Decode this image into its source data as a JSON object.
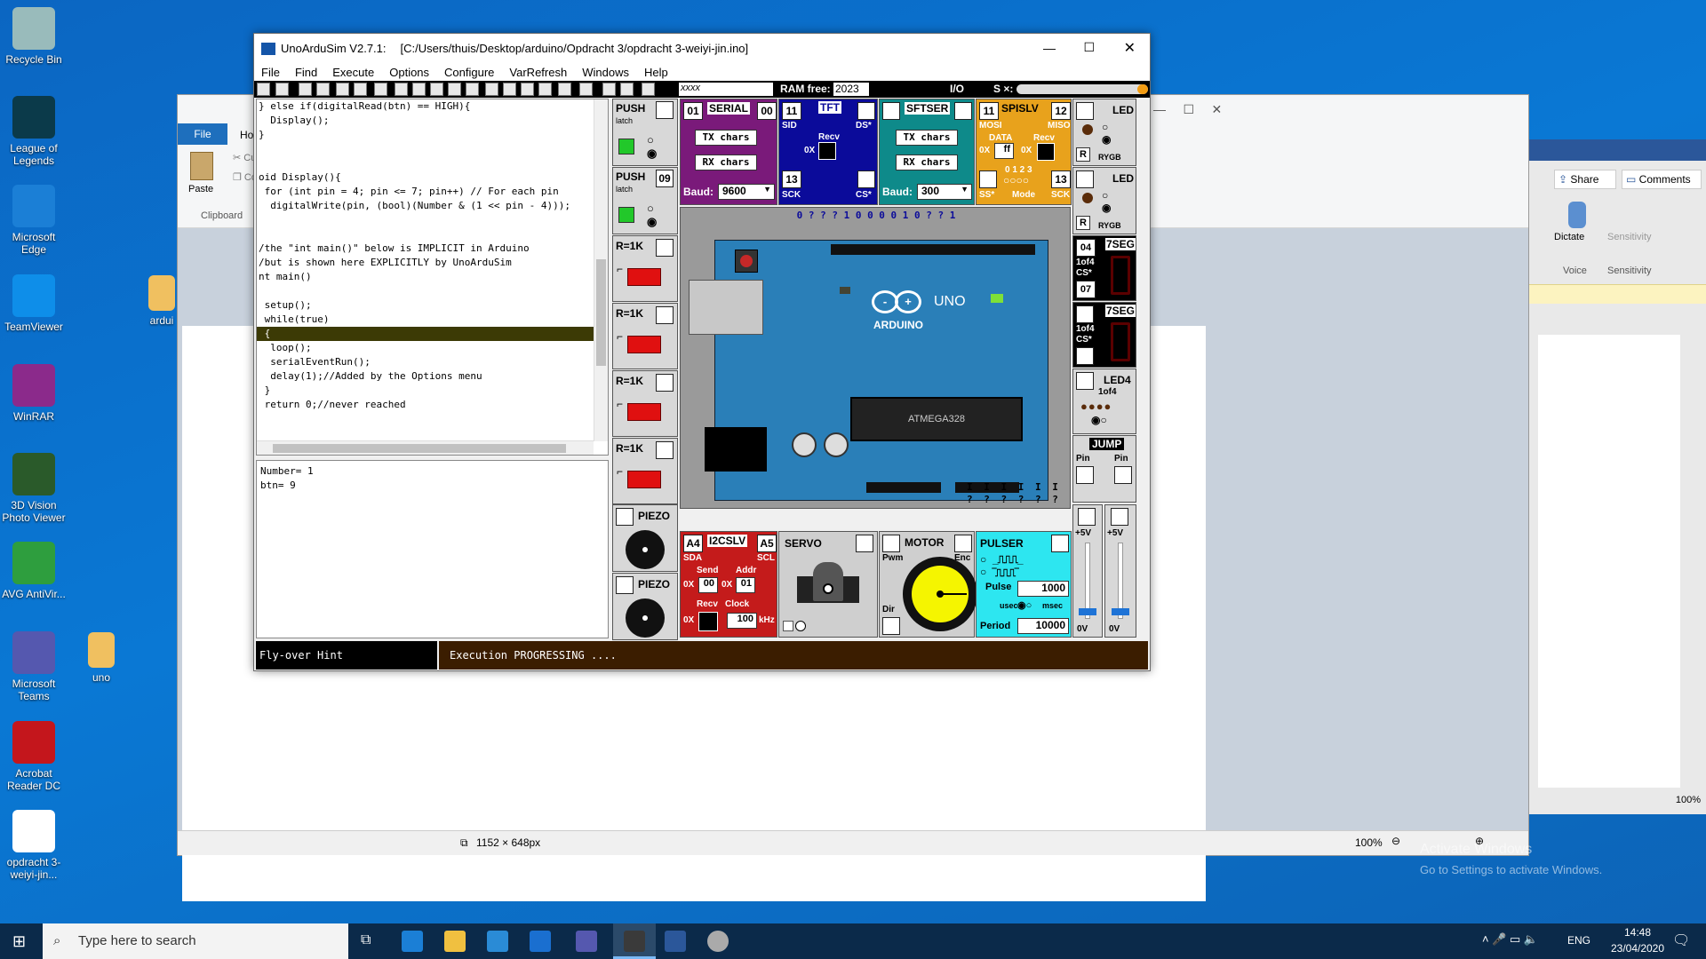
{
  "desktop": {
    "icons": [
      {
        "label": "Recycle Bin",
        "color": "#9bb"
      },
      {
        "label": "League of Legends",
        "color": "#0b3a4a"
      },
      {
        "label": "Microsoft Edge",
        "color": "#1b7fd6"
      },
      {
        "label": "TeamViewer",
        "color": "#0e8ee9"
      },
      {
        "label": "WinRAR",
        "color": "#8b2a8b"
      },
      {
        "label": "3D Vision Photo Viewer",
        "color": "#2a5a2a"
      },
      {
        "label": "AVG AntiVir...",
        "color": "#2e9e3e"
      },
      {
        "label": "Microsoft Teams",
        "color": "#5558af"
      },
      {
        "label": "Acrobat Reader DC",
        "color": "#c4161c"
      },
      {
        "label": "opdracht 3-weiyi-jin...",
        "color": "#ffffff"
      }
    ],
    "extra_icons": [
      {
        "label": "ardui",
        "color": "#f0c060"
      },
      {
        "label": "uno",
        "color": "#f0c060"
      }
    ],
    "activate_title": "Activate Windows",
    "activate_sub": "Go to Settings to activate Windows."
  },
  "paint": {
    "file_tab": "File",
    "home_tab": "Ho",
    "paste": "Paste",
    "cut": "Cut",
    "copy": "Co",
    "clipboard": "Clipboard",
    "status_size": "1152 × 648px",
    "zoom": "100%"
  },
  "word": {
    "share": "Share",
    "comments": "Comments",
    "dictate": "Dictate",
    "sensitivity": "Sensitivity",
    "voice": "Voice",
    "sensitivity_group": "Sensitivity",
    "zoom": "100%"
  },
  "sim": {
    "title": "UnoArduSim V2.7.1:",
    "path": "[C:/Users/thuis/Desktop/arduino/Opdracht 3/opdracht 3-weiyi-jin.ino]",
    "menu": [
      "File",
      "Find",
      "Execute",
      "Options",
      "Configure",
      "VarRefresh",
      "Windows",
      "Help"
    ],
    "toolbar_field": "xxxx",
    "ram_label": "RAM free:",
    "ram_value": "2023",
    "io_label": "I/O",
    "io_s": "S ×:",
    "code_lines": [
      "} else if(digitalRead(btn) == HIGH){",
      "  Display();",
      "}",
      "",
      "",
      "oid Display(){",
      " for (int pin = 4; pin <= 7; pin++) // For each pin",
      "  digitalWrite(pin, (bool)(Number & (1 << pin - 4)));",
      "",
      "",
      "/the \"int main()\" below is IMPLICIT in Arduino",
      "/but is shown here EXPLICITLY by UnoArduSim",
      "nt main()",
      "",
      " setup();",
      " while(true)",
      " {",
      "  loop();",
      "  serialEventRun();",
      "  delay(1);//Added by the Options menu",
      " }",
      " return 0;//never reached"
    ],
    "highlight_line": 16,
    "output_lines": [
      "Number= 1",
      "btn= 9"
    ],
    "hint": "Fly-over Hint",
    "status": "Execution PROGRESSING ....",
    "push1": {
      "label": "PUSH",
      "mode": "latch",
      "pin": ""
    },
    "push2": {
      "label": "PUSH",
      "mode": "latch",
      "pin": "09"
    },
    "r1k": [
      "R=1K",
      "R=1K",
      "R=1K",
      "R=1K"
    ],
    "piezo": [
      "PIEZO",
      "PIEZO"
    ],
    "serial": {
      "pin_a": "01",
      "title": "SERIAL",
      "pin_b": "00",
      "tx": "TX chars",
      "rx": "RX chars",
      "baud_label": "Baud:",
      "baud": "9600"
    },
    "tft": {
      "pin": "11",
      "title": "TFT",
      "sid": "SID",
      "ds": "DS*",
      "recv": "Recv",
      "ox": "0X",
      "sck_pin": "13",
      "sck": "SCK",
      "cs": "CS*"
    },
    "sftser": {
      "title": "SFTSER",
      "tx": "TX chars",
      "rx": "RX chars",
      "baud_label": "Baud:",
      "baud": "300"
    },
    "spislv": {
      "pin_a": "11",
      "title": "SPISLV",
      "pin_b": "12",
      "mosi": "MOSI",
      "miso": "MISO",
      "data": "DATA",
      "recv": "Recv",
      "ox": "0X",
      "ff": "ff",
      "ox2": "0X",
      "modes": "0 1 2 3",
      "ss": "SS*",
      "mode": "Mode",
      "sck_pin": "13",
      "sck": "SCK"
    },
    "led1": {
      "label": "LED",
      "rygb": "RYGB",
      "r": "R"
    },
    "led2": {
      "label": "LED",
      "rygb": "RYGB",
      "r": "R"
    },
    "seg1": {
      "pin": "04",
      "title": "7SEG",
      "of": "1of4",
      "cs": "CS*",
      "pin2": "07"
    },
    "seg2": {
      "title": "7SEG",
      "of": "1of4",
      "cs": "CS*"
    },
    "led4": {
      "title": "LED4",
      "of": "1of4"
    },
    "jump": {
      "title": "JUMP",
      "pin_a": "Pin",
      "pin_b": "Pin"
    },
    "v5": [
      "+5V",
      "+5V"
    ],
    "v0": [
      "0V",
      "0V"
    ],
    "i2c": {
      "pin_a": "A4",
      "title": "I2CSLV",
      "pin_b": "A5",
      "sda": "SDA",
      "scl": "SCL",
      "send": "Send",
      "addr": "Addr",
      "ox": "0X",
      "send_val": "00",
      "addr_val": "01",
      "recv": "Recv",
      "clock": "Clock",
      "clock_val": "100",
      "khz": "kHz"
    },
    "servo": {
      "title": "SERVO"
    },
    "motor": {
      "title": "MOTOR",
      "pwm": "Pwm",
      "enc": "Enc",
      "dir": "Dir"
    },
    "pulser": {
      "title": "PULSER",
      "pulse": "Pulse",
      "pulse_val": "1000",
      "usec": "usec",
      "msec": "msec",
      "period": "Period",
      "period_val": "10000"
    },
    "board": {
      "uno": "UNO",
      "arduino": "ARDUINO",
      "chip": "ATMEGA328",
      "pin_states": "0 ? ? ? 1 0   0 0 0 1 0 ? ? 1",
      "analog": "I I I I I I",
      "analog_q": "? ? ? ? ? ?"
    }
  },
  "taskbar": {
    "search": "Type here to search",
    "lang": "ENG",
    "time": "14:48",
    "date": "23/04/2020"
  }
}
